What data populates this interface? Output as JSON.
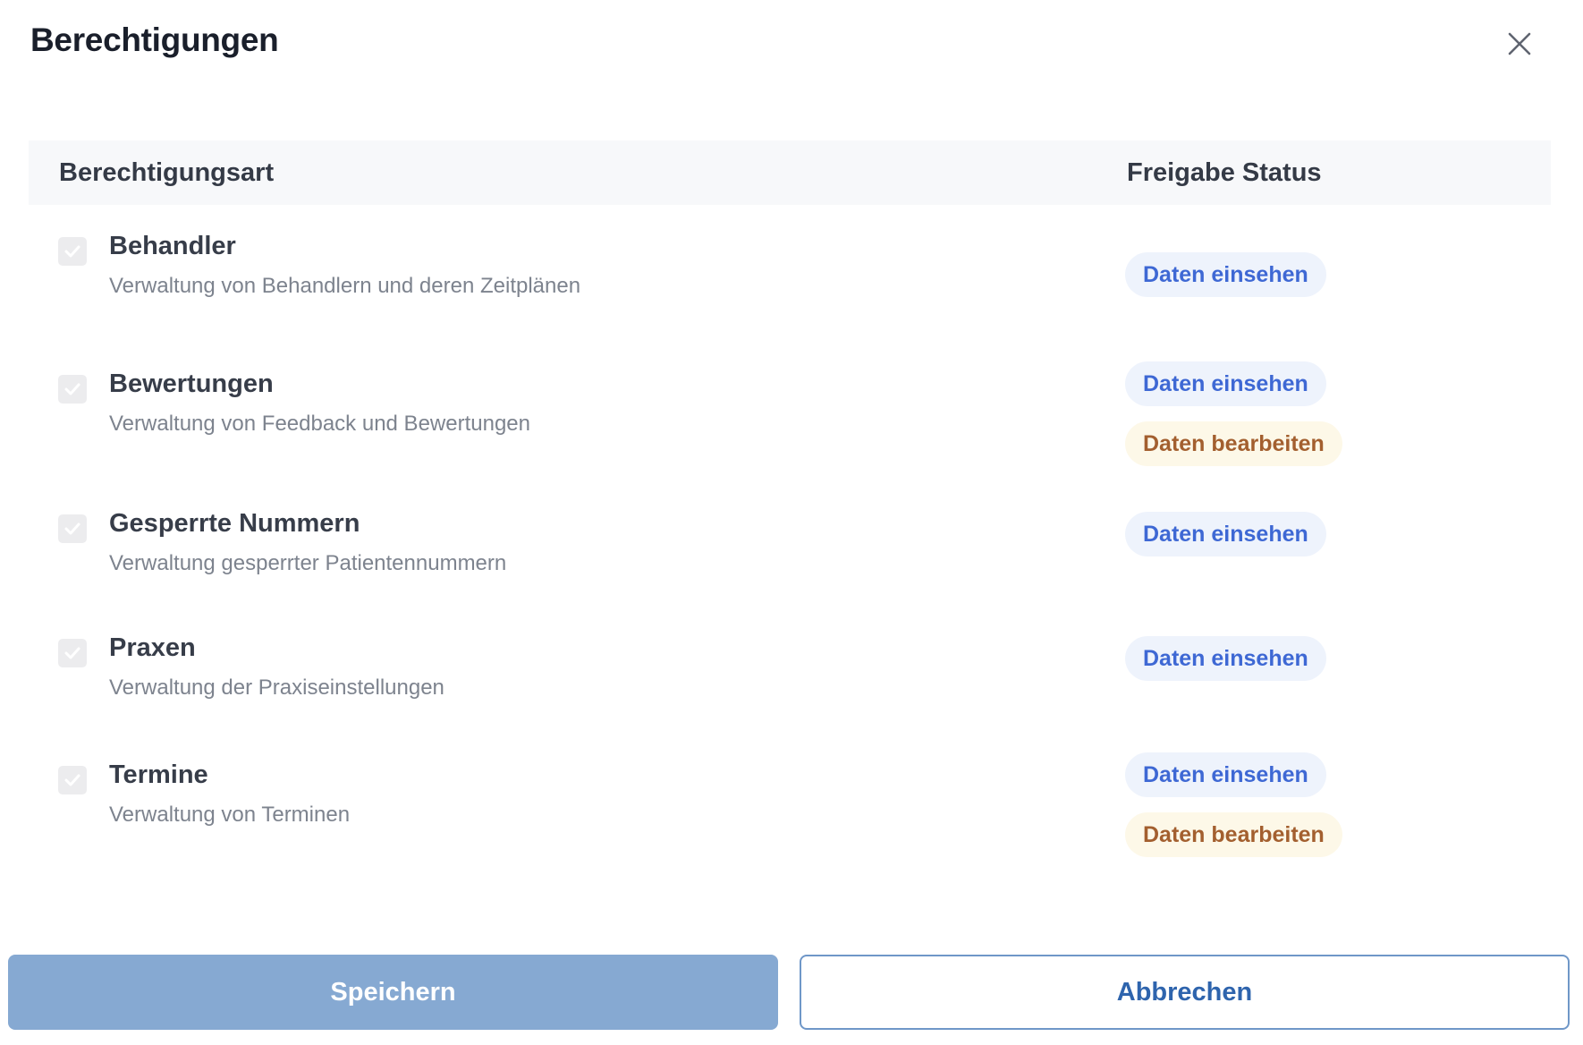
{
  "dialog": {
    "title": "Berechtigungen",
    "close_icon": "close-icon"
  },
  "table": {
    "headers": {
      "type": "Berechtigungsart",
      "status": "Freigabe Status"
    },
    "rows": [
      {
        "checked": true,
        "title": "Behandler",
        "description": "Verwaltung von Behandlern und deren Zeitplänen",
        "badges": [
          {
            "label": "Daten einsehen",
            "kind": "view"
          }
        ]
      },
      {
        "checked": true,
        "title": "Bewertungen",
        "description": "Verwaltung von Feedback und Bewertungen",
        "badges": [
          {
            "label": "Daten einsehen",
            "kind": "view"
          },
          {
            "label": "Daten bearbeiten",
            "kind": "edit"
          }
        ]
      },
      {
        "checked": true,
        "title": "Gesperrte Nummern",
        "description": "Verwaltung gesperrter Patientennummern",
        "badges": [
          {
            "label": "Daten einsehen",
            "kind": "view"
          }
        ]
      },
      {
        "checked": true,
        "title": "Praxen",
        "description": "Verwaltung der Praxiseinstellungen",
        "badges": [
          {
            "label": "Daten einsehen",
            "kind": "view"
          }
        ]
      },
      {
        "checked": true,
        "title": "Termine",
        "description": "Verwaltung von Terminen",
        "badges": [
          {
            "label": "Daten einsehen",
            "kind": "view"
          },
          {
            "label": "Daten bearbeiten",
            "kind": "edit"
          }
        ]
      }
    ]
  },
  "footer": {
    "save_label": "Speichern",
    "cancel_label": "Abbrechen"
  },
  "colors": {
    "view_badge_bg": "#eef3fc",
    "view_badge_text": "#3e68d4",
    "edit_badge_bg": "#fdf8e8",
    "edit_badge_text": "#a35f2f",
    "save_button_bg": "#86a9d2",
    "cancel_button_border": "#6f97c8"
  }
}
